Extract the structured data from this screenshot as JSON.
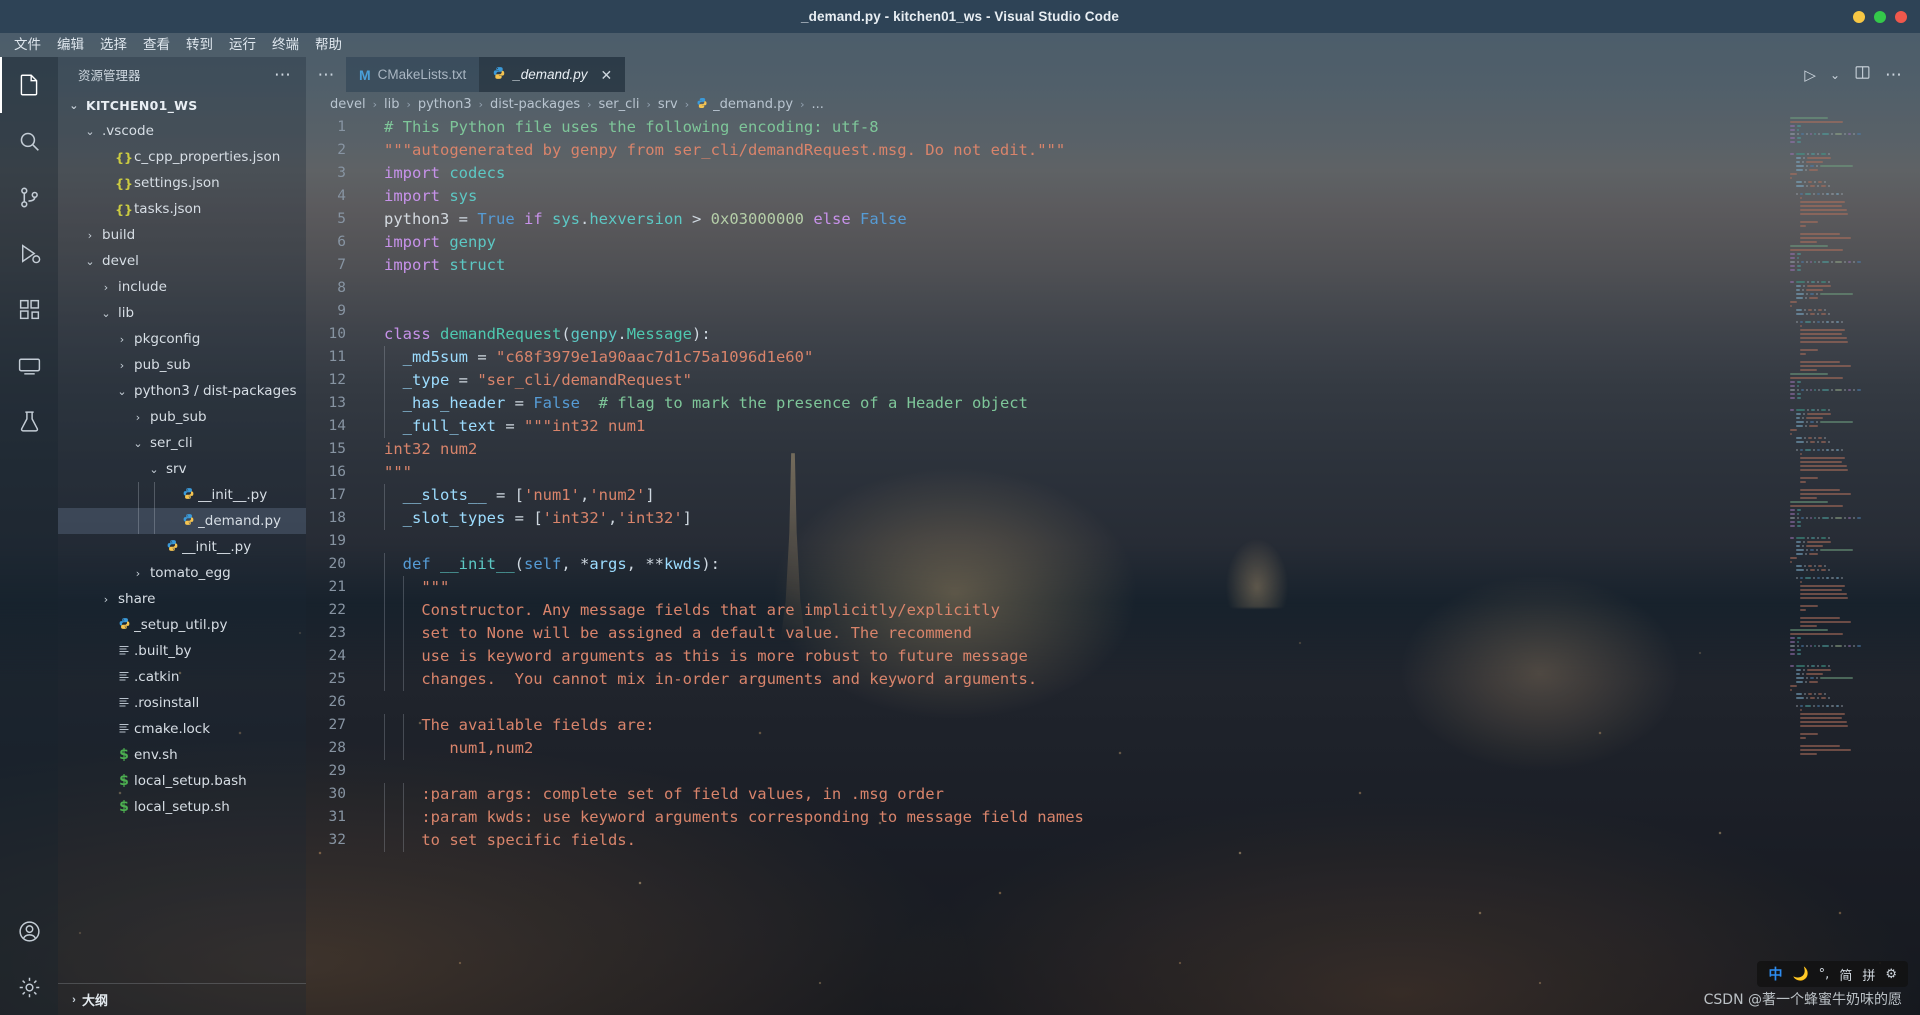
{
  "window": {
    "title": "_demand.py - kitchen01_ws - Visual Studio Code",
    "buttons": [
      {
        "name": "minimize",
        "color": "#f7c744"
      },
      {
        "name": "maximize",
        "color": "#34c84a"
      },
      {
        "name": "close",
        "color": "#f0584c"
      }
    ]
  },
  "menubar": {
    "items": [
      {
        "label": "文件"
      },
      {
        "label": "编辑"
      },
      {
        "label": "选择"
      },
      {
        "label": "查看"
      },
      {
        "label": "转到"
      },
      {
        "label": "运行"
      },
      {
        "label": "终端"
      },
      {
        "label": "帮助"
      }
    ]
  },
  "activitybar": {
    "items": [
      {
        "name": "explorer",
        "icon": "files-icon",
        "active": true
      },
      {
        "name": "search",
        "icon": "search-icon",
        "active": false
      },
      {
        "name": "source-control",
        "icon": "source-control-icon",
        "active": false
      },
      {
        "name": "run-and-debug",
        "icon": "run-debug-icon",
        "active": false
      },
      {
        "name": "extensions",
        "icon": "extensions-icon",
        "active": false
      },
      {
        "name": "remote-explorer",
        "icon": "remote-icon",
        "active": false
      },
      {
        "name": "testing",
        "icon": "beaker-icon",
        "active": false
      }
    ],
    "bottom": [
      {
        "name": "accounts",
        "icon": "account-icon"
      },
      {
        "name": "manage",
        "icon": "gear-icon"
      }
    ]
  },
  "sidebar": {
    "header": {
      "title": "资源管理器",
      "more": "⋯"
    },
    "root": "KITCHEN01_WS",
    "outline": {
      "label": "大纲",
      "chevron": "›"
    },
    "tree": [
      {
        "label": "KITCHEN01_WS",
        "depth": 0,
        "type": "root",
        "chevron": "⌄",
        "icon": "",
        "selected": false
      },
      {
        "label": ".vscode",
        "depth": 1,
        "type": "folder",
        "chevron": "⌄",
        "icon": "",
        "selected": false
      },
      {
        "label": "c_cpp_properties.json",
        "depth": 2,
        "type": "json",
        "chevron": "",
        "icon": "{}",
        "selected": false
      },
      {
        "label": "settings.json",
        "depth": 2,
        "type": "json",
        "chevron": "",
        "icon": "{}",
        "selected": false
      },
      {
        "label": "tasks.json",
        "depth": 2,
        "type": "json",
        "chevron": "",
        "icon": "{}",
        "selected": false
      },
      {
        "label": "build",
        "depth": 1,
        "type": "folder",
        "chevron": "›",
        "icon": "",
        "selected": false
      },
      {
        "label": "devel",
        "depth": 1,
        "type": "folder",
        "chevron": "⌄",
        "icon": "",
        "selected": false
      },
      {
        "label": "include",
        "depth": 2,
        "type": "folder",
        "chevron": "›",
        "icon": "",
        "selected": false
      },
      {
        "label": "lib",
        "depth": 2,
        "type": "folder",
        "chevron": "⌄",
        "icon": "",
        "selected": false
      },
      {
        "label": "pkgconfig",
        "depth": 3,
        "type": "folder",
        "chevron": "›",
        "icon": "",
        "selected": false
      },
      {
        "label": "pub_sub",
        "depth": 3,
        "type": "folder",
        "chevron": "›",
        "icon": "",
        "selected": false
      },
      {
        "label": "python3 / dist-packages",
        "depth": 3,
        "type": "folder",
        "chevron": "⌄",
        "icon": "",
        "selected": false
      },
      {
        "label": "pub_sub",
        "depth": 4,
        "type": "folder",
        "chevron": "›",
        "icon": "",
        "selected": false
      },
      {
        "label": "ser_cli",
        "depth": 4,
        "type": "folder",
        "chevron": "⌄",
        "icon": "",
        "selected": false
      },
      {
        "label": "srv",
        "depth": 5,
        "type": "folder",
        "chevron": "⌄",
        "icon": "",
        "selected": false
      },
      {
        "label": "__init__.py",
        "depth": 6,
        "type": "py",
        "chevron": "",
        "icon": "py",
        "selected": false
      },
      {
        "label": "_demand.py",
        "depth": 6,
        "type": "py",
        "chevron": "",
        "icon": "py",
        "selected": true
      },
      {
        "label": "__init__.py",
        "depth": 5,
        "type": "py",
        "chevron": "",
        "icon": "py",
        "selected": false
      },
      {
        "label": "tomato_egg",
        "depth": 4,
        "type": "folder",
        "chevron": "›",
        "icon": "",
        "selected": false
      },
      {
        "label": "share",
        "depth": 2,
        "type": "folder",
        "chevron": "›",
        "icon": "",
        "selected": false
      },
      {
        "label": "_setup_util.py",
        "depth": 2,
        "type": "py",
        "chevron": "",
        "icon": "py",
        "selected": false
      },
      {
        "label": ".built_by",
        "depth": 2,
        "type": "txt",
        "chevron": "",
        "icon": "txt",
        "selected": false
      },
      {
        "label": ".catkin",
        "depth": 2,
        "type": "txt",
        "chevron": "",
        "icon": "txt",
        "selected": false
      },
      {
        "label": ".rosinstall",
        "depth": 2,
        "type": "txt",
        "chevron": "",
        "icon": "txt",
        "selected": false
      },
      {
        "label": "cmake.lock",
        "depth": 2,
        "type": "txt",
        "chevron": "",
        "icon": "txt",
        "selected": false
      },
      {
        "label": "env.sh",
        "depth": 2,
        "type": "sh",
        "chevron": "",
        "icon": "$",
        "selected": false
      },
      {
        "label": "local_setup.bash",
        "depth": 2,
        "type": "sh",
        "chevron": "",
        "icon": "$",
        "selected": false
      },
      {
        "label": "local_setup.sh",
        "depth": 2,
        "type": "sh",
        "chevron": "",
        "icon": "$",
        "selected": false
      }
    ]
  },
  "editor": {
    "tabs": [
      {
        "label": "CMakeLists.txt",
        "icon": "M",
        "icon_name": "cmake-icon",
        "active": false,
        "closable": false
      },
      {
        "label": "_demand.py",
        "icon": "py",
        "icon_name": "python-icon",
        "active": true,
        "closable": true,
        "close": "✕"
      }
    ],
    "tab_overflow": "⋯",
    "actions": [
      {
        "name": "run-python-file",
        "icon": "run-icon",
        "glyph": "▷"
      },
      {
        "name": "run-options-dropdown",
        "icon": "chevron-down-icon",
        "glyph": "⌄"
      },
      {
        "name": "split-editor-right",
        "icon": "split-editor-icon",
        "glyph": "▯"
      },
      {
        "name": "toggle-panel",
        "icon": "layout-icon",
        "glyph": "⋯"
      }
    ],
    "breadcrumb": [
      "devel",
      "lib",
      "python3",
      "dist-packages",
      "ser_cli",
      "srv",
      "_demand.py",
      "..."
    ],
    "breadcrumb_separator": "›",
    "code": [
      {
        "n": 1,
        "tokens": [
          {
            "t": "# This Python file uses the following encoding: utf-8",
            "c": "com"
          }
        ],
        "indent": 0
      },
      {
        "n": 2,
        "tokens": [
          {
            "t": "\"\"\"autogenerated by genpy from ser_cli/demandRequest.msg. Do not edit.\"\"\"",
            "c": "str"
          }
        ],
        "indent": 0
      },
      {
        "n": 3,
        "tokens": [
          {
            "t": "import ",
            "c": "kw"
          },
          {
            "t": "codecs",
            "c": "fn"
          }
        ],
        "indent": 0
      },
      {
        "n": 4,
        "tokens": [
          {
            "t": "import ",
            "c": "kw"
          },
          {
            "t": "sys",
            "c": "fn"
          }
        ],
        "indent": 0
      },
      {
        "n": 5,
        "tokens": [
          {
            "t": "python3",
            "c": "plain"
          },
          {
            "t": " = ",
            "c": "op"
          },
          {
            "t": "True",
            "c": "kw2"
          },
          {
            "t": " ",
            "c": "op"
          },
          {
            "t": "if",
            "c": "kw"
          },
          {
            "t": " sys",
            "c": "fn"
          },
          {
            "t": ".",
            "c": "op"
          },
          {
            "t": "hexversion",
            "c": "fn"
          },
          {
            "t": " > ",
            "c": "op"
          },
          {
            "t": "0x03000000",
            "c": "num"
          },
          {
            "t": " ",
            "c": "op"
          },
          {
            "t": "else",
            "c": "kw"
          },
          {
            "t": " ",
            "c": "op"
          },
          {
            "t": "False",
            "c": "kw2"
          }
        ],
        "indent": 0
      },
      {
        "n": 6,
        "tokens": [
          {
            "t": "import ",
            "c": "kw"
          },
          {
            "t": "genpy",
            "c": "fn"
          }
        ],
        "indent": 0
      },
      {
        "n": 7,
        "tokens": [
          {
            "t": "import ",
            "c": "kw"
          },
          {
            "t": "struct",
            "c": "fn"
          }
        ],
        "indent": 0
      },
      {
        "n": 8,
        "tokens": [],
        "indent": 0
      },
      {
        "n": 9,
        "tokens": [],
        "indent": 0
      },
      {
        "n": 10,
        "tokens": [
          {
            "t": "class ",
            "c": "kw"
          },
          {
            "t": "demandRequest",
            "c": "cls"
          },
          {
            "t": "(",
            "c": "op"
          },
          {
            "t": "genpy",
            "c": "fn"
          },
          {
            "t": ".",
            "c": "op"
          },
          {
            "t": "Message",
            "c": "cls"
          },
          {
            "t": "):",
            "c": "op"
          }
        ],
        "indent": 0
      },
      {
        "n": 11,
        "tokens": [
          {
            "t": "  _md5sum",
            "c": "var"
          },
          {
            "t": " = ",
            "c": "op"
          },
          {
            "t": "\"c68f3979e1a90aac7d1c75a1096d1e60\"",
            "c": "str"
          }
        ],
        "indent": 1
      },
      {
        "n": 12,
        "tokens": [
          {
            "t": "  _type",
            "c": "var"
          },
          {
            "t": " = ",
            "c": "op"
          },
          {
            "t": "\"ser_cli/demandRequest\"",
            "c": "str"
          }
        ],
        "indent": 1
      },
      {
        "n": 13,
        "tokens": [
          {
            "t": "  _has_header",
            "c": "var"
          },
          {
            "t": " = ",
            "c": "op"
          },
          {
            "t": "False",
            "c": "kw2"
          },
          {
            "t": "  ",
            "c": "op"
          },
          {
            "t": "# flag to mark the presence of a Header object",
            "c": "com"
          }
        ],
        "indent": 1
      },
      {
        "n": 14,
        "tokens": [
          {
            "t": "  _full_text",
            "c": "var"
          },
          {
            "t": " = ",
            "c": "op"
          },
          {
            "t": "\"\"\"int32 num1",
            "c": "str"
          }
        ],
        "indent": 1
      },
      {
        "n": 15,
        "tokens": [
          {
            "t": "int32 num2",
            "c": "str"
          }
        ],
        "indent": 0
      },
      {
        "n": 16,
        "tokens": [
          {
            "t": "\"\"\"",
            "c": "str"
          }
        ],
        "indent": 0
      },
      {
        "n": 17,
        "tokens": [
          {
            "t": "  __slots__",
            "c": "var"
          },
          {
            "t": " = [",
            "c": "op"
          },
          {
            "t": "'num1'",
            "c": "str"
          },
          {
            "t": ",",
            "c": "op"
          },
          {
            "t": "'num2'",
            "c": "str"
          },
          {
            "t": "]",
            "c": "op"
          }
        ],
        "indent": 1
      },
      {
        "n": 18,
        "tokens": [
          {
            "t": "  _slot_types",
            "c": "var"
          },
          {
            "t": " = [",
            "c": "op"
          },
          {
            "t": "'int32'",
            "c": "str"
          },
          {
            "t": ",",
            "c": "op"
          },
          {
            "t": "'int32'",
            "c": "str"
          },
          {
            "t": "]",
            "c": "op"
          }
        ],
        "indent": 1
      },
      {
        "n": 19,
        "tokens": [],
        "indent": 0
      },
      {
        "n": 20,
        "tokens": [
          {
            "t": "  ",
            "c": "op"
          },
          {
            "t": "def ",
            "c": "def"
          },
          {
            "t": "__init__",
            "c": "fn"
          },
          {
            "t": "(",
            "c": "op"
          },
          {
            "t": "self",
            "c": "kw2"
          },
          {
            "t": ", *",
            "c": "op"
          },
          {
            "t": "args",
            "c": "var"
          },
          {
            "t": ", **",
            "c": "op"
          },
          {
            "t": "kwds",
            "c": "var"
          },
          {
            "t": "):",
            "c": "op"
          }
        ],
        "indent": 1
      },
      {
        "n": 21,
        "tokens": [
          {
            "t": "    \"\"\"",
            "c": "str"
          }
        ],
        "indent": 2
      },
      {
        "n": 22,
        "tokens": [
          {
            "t": "    Constructor. Any message fields that are implicitly/explicitly",
            "c": "str"
          }
        ],
        "indent": 2
      },
      {
        "n": 23,
        "tokens": [
          {
            "t": "    set to None will be assigned a default value. The recommend",
            "c": "str"
          }
        ],
        "indent": 2
      },
      {
        "n": 24,
        "tokens": [
          {
            "t": "    use is keyword arguments as this is more robust to future message",
            "c": "str"
          }
        ],
        "indent": 2
      },
      {
        "n": 25,
        "tokens": [
          {
            "t": "    changes.  You cannot mix in-order arguments and keyword arguments.",
            "c": "str"
          }
        ],
        "indent": 2
      },
      {
        "n": 26,
        "tokens": [],
        "indent": 2
      },
      {
        "n": 27,
        "tokens": [
          {
            "t": "    The available fields are:",
            "c": "str"
          }
        ],
        "indent": 2
      },
      {
        "n": 28,
        "tokens": [
          {
            "t": "       num1,num2",
            "c": "str"
          }
        ],
        "indent": 2
      },
      {
        "n": 29,
        "tokens": [],
        "indent": 2
      },
      {
        "n": 30,
        "tokens": [
          {
            "t": "    :param args: complete set of field values, in .msg order",
            "c": "str"
          }
        ],
        "indent": 2
      },
      {
        "n": 31,
        "tokens": [
          {
            "t": "    :param kwds: use keyword arguments corresponding to message field names",
            "c": "str"
          }
        ],
        "indent": 2
      },
      {
        "n": 32,
        "tokens": [
          {
            "t": "    to set specific fields.",
            "c": "str"
          }
        ],
        "indent": 2
      }
    ]
  },
  "ime": {
    "items": [
      {
        "name": "language-mode",
        "glyph": "中",
        "style": "z"
      },
      {
        "name": "moon-icon",
        "glyph": "🌙",
        "style": "w"
      },
      {
        "name": "punctuation-mode",
        "glyph": "°,",
        "style": "w"
      },
      {
        "name": "simplified-chinese",
        "glyph": "简",
        "style": "w"
      },
      {
        "name": "pinyin-mode",
        "glyph": "拼",
        "style": "w"
      },
      {
        "name": "gear-icon",
        "glyph": "⚙",
        "style": "w"
      }
    ]
  },
  "watermark": "CSDN @著一个蜂蜜牛奶味的愿",
  "colors": {
    "titlebar": "#2e4356",
    "accent": "#3b9ad9",
    "selection": "#8296b4",
    "comment": "#7ec699",
    "string": "#d9846b"
  }
}
